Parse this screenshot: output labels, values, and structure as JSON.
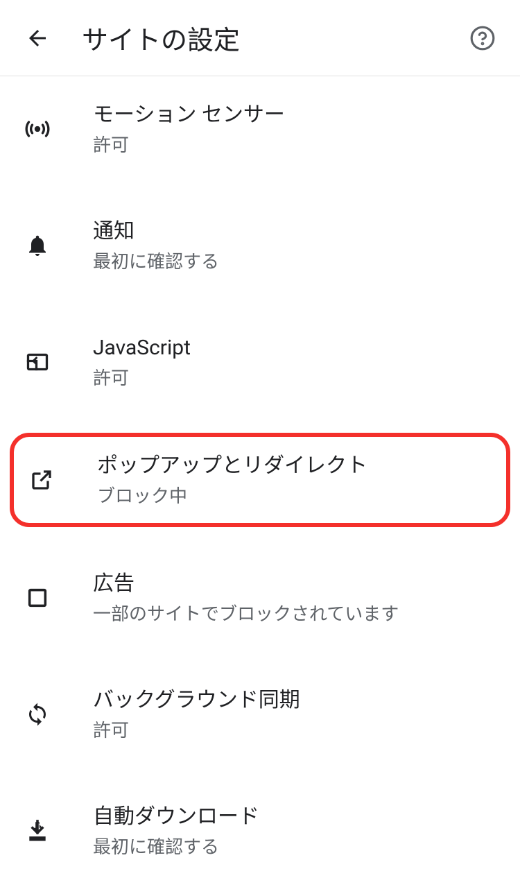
{
  "header": {
    "title": "サイトの設定"
  },
  "items": [
    {
      "title": "モーション センサー",
      "subtitle": "許可",
      "icon": "motion-sensor",
      "highlighted": false
    },
    {
      "title": "通知",
      "subtitle": "最初に確認する",
      "icon": "notifications",
      "highlighted": false
    },
    {
      "title": "JavaScript",
      "subtitle": "許可",
      "icon": "javascript",
      "highlighted": false
    },
    {
      "title": "ポップアップとリダイレクト",
      "subtitle": "ブロック中",
      "icon": "open-external",
      "highlighted": true
    },
    {
      "title": "広告",
      "subtitle": "一部のサイトでブロックされています",
      "icon": "ads",
      "highlighted": false
    },
    {
      "title": "バックグラウンド同期",
      "subtitle": "許可",
      "icon": "sync",
      "highlighted": false
    },
    {
      "title": "自動ダウンロード",
      "subtitle": "最初に確認する",
      "icon": "download",
      "highlighted": false
    }
  ]
}
